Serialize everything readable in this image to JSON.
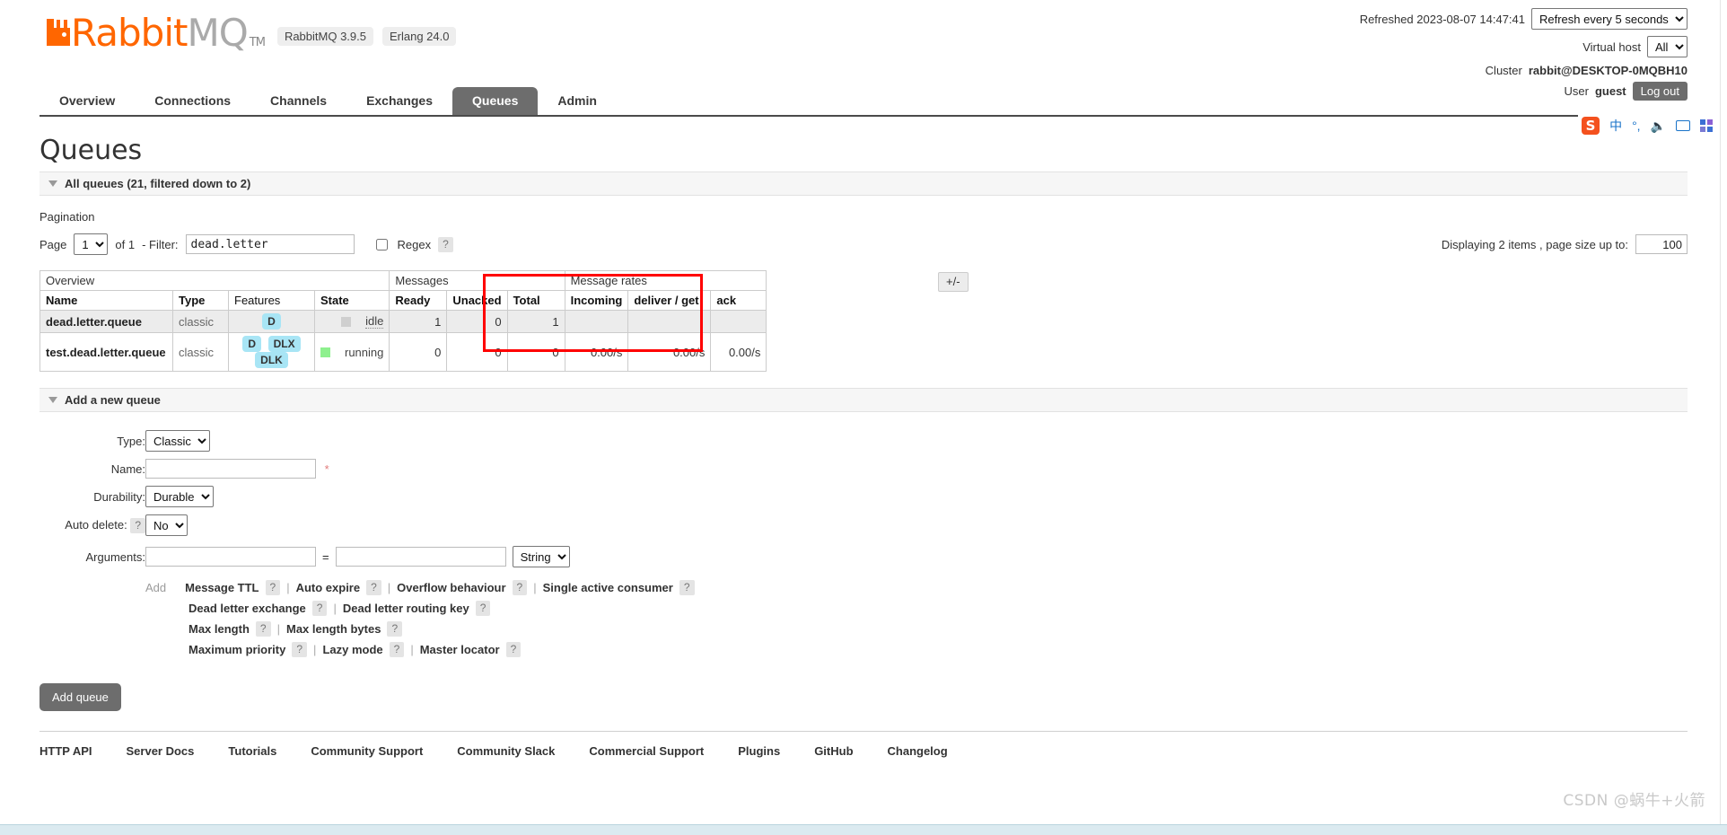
{
  "header": {
    "logo_text_primary": "Rabbit",
    "logo_text_secondary": "MQ",
    "logo_tm": "TM",
    "version_badges": [
      "RabbitMQ 3.9.5",
      "Erlang 24.0"
    ],
    "refreshed_label": "Refreshed 2023-08-07 14:47:41",
    "refresh_select": "Refresh every 5 seconds",
    "vhost_label": "Virtual host",
    "vhost_select": "All",
    "cluster_label": "Cluster",
    "cluster_name": "rabbit@DESKTOP-0MQBH10",
    "user_label": "User",
    "user_name": "guest",
    "logout_label": "Log out"
  },
  "nav": {
    "items": [
      {
        "label": "Overview",
        "active": false
      },
      {
        "label": "Connections",
        "active": false
      },
      {
        "label": "Channels",
        "active": false
      },
      {
        "label": "Exchanges",
        "active": false
      },
      {
        "label": "Queues",
        "active": true
      },
      {
        "label": "Admin",
        "active": false
      }
    ]
  },
  "page": {
    "title": "Queues",
    "all_queues_bar": "All queues (21, filtered down to 2)",
    "pagination_label": "Pagination"
  },
  "pagination": {
    "page_label": "Page",
    "page_value": "1",
    "of_label": "of 1",
    "filter_label": "- Filter:",
    "filter_value": "dead.letter",
    "filter_placeholder": "",
    "regex_label": "Regex",
    "help_mark": "?",
    "displaying_label": "Displaying 2 items , page size up to:",
    "page_size_value": "100"
  },
  "table": {
    "group_headers": [
      "Overview",
      "Messages",
      "Message rates"
    ],
    "plus_minus_label": "+/-",
    "columns": [
      "Name",
      "Type",
      "Features",
      "State",
      "Ready",
      "Unacked",
      "Total",
      "Incoming",
      "deliver / get",
      "ack"
    ],
    "rows": [
      {
        "name": "dead.letter.queue",
        "type": "classic",
        "features": [
          "D"
        ],
        "state": "idle",
        "state_color": "gray",
        "ready": "1",
        "unacked": "0",
        "total": "1",
        "incoming": "",
        "deliver_get": "",
        "ack": ""
      },
      {
        "name": "test.dead.letter.queue",
        "type": "classic",
        "features": [
          "D",
          "DLX",
          "DLK"
        ],
        "state": "running",
        "state_color": "green",
        "ready": "0",
        "unacked": "0",
        "total": "0",
        "incoming": "0.00/s",
        "deliver_get": "0.00/s",
        "ack": "0.00/s"
      }
    ]
  },
  "add_queue": {
    "section_title": "Add a new queue",
    "type_label": "Type:",
    "type_value": "Classic",
    "name_label": "Name:",
    "name_value": "",
    "name_required_mark": "*",
    "durability_label": "Durability:",
    "durability_value": "Durable",
    "auto_delete_label": "Auto delete:",
    "auto_delete_value": "No",
    "arguments_label": "Arguments:",
    "arg_key_value": "",
    "arg_value_value": "",
    "arg_equals": "=",
    "arg_type_value": "String",
    "add_label": "Add",
    "preset_rows": [
      [
        "Message TTL",
        "Auto expire",
        "Overflow behaviour",
        "Single active consumer"
      ],
      [
        "Dead letter exchange",
        "Dead letter routing key"
      ],
      [
        "Max length",
        "Max length bytes"
      ],
      [
        "Maximum priority",
        "Lazy mode",
        "Master locator"
      ]
    ],
    "submit_label": "Add queue"
  },
  "footer": {
    "links": [
      "HTTP API",
      "Server Docs",
      "Tutorials",
      "Community Support",
      "Community Slack",
      "Commercial Support",
      "Plugins",
      "GitHub",
      "Changelog"
    ]
  },
  "ime": {
    "logo": "S",
    "mode_cn": "中",
    "punct": "°,"
  },
  "watermark": {
    "text": "CSDN @蜗牛+火箭"
  },
  "colors": {
    "brand_orange": "#ff6600",
    "tab_active": "#6d6d6d",
    "feature_badge": "#a8e5f5",
    "state_running": "#8ef08e",
    "highlight_rect": "#ff0000"
  }
}
